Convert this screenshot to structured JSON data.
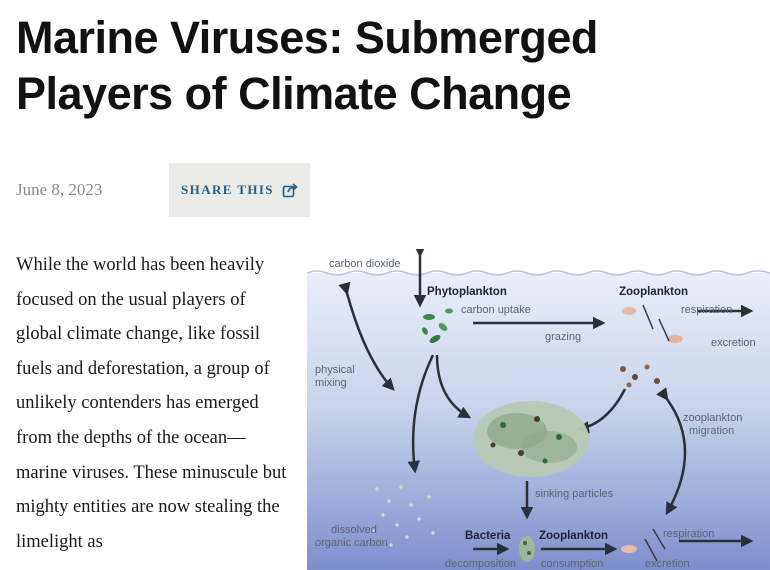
{
  "article": {
    "title": "Marine Viruses: Submerged Players of Climate Change",
    "date": "June 8, 2023",
    "share_label": "SHARE THIS",
    "body": "While the world has been heavily focused on the usual players of global climate change, like fossil fuels and deforestation, a group of unlikely contenders has emerged from the depths of the ocean—marine viruses. These minuscule but mighty entities are now stealing the limelight as"
  },
  "icons": {
    "share": "share-icon"
  },
  "colors": {
    "share_text": "#1f5f86",
    "share_bg": "#ebebe8",
    "date": "#8a8a8a"
  },
  "figure": {
    "labels": {
      "carbon_dioxide": "carbon dioxide",
      "phytoplankton": "Phytoplankton",
      "carbon_uptake": "carbon uptake",
      "zooplankton_top": "Zooplankton",
      "respiration_top": "respiration",
      "excretion_top": "excretion",
      "grazing": "grazing",
      "physical": "physical",
      "mixing": "mixing",
      "zoo_migration_1": "zooplankton",
      "zoo_migration_2": "migration",
      "sinking_particles": "sinking particles",
      "dissolved": "dissolved",
      "organic_carbon": "organic carbon",
      "bacteria": "Bacteria",
      "zooplankton_bottom": "Zooplankton",
      "respiration_bottom": "respiration",
      "decomposition": "decomposition",
      "consumption": "consumption",
      "excretion_bottom": "excretion"
    }
  }
}
